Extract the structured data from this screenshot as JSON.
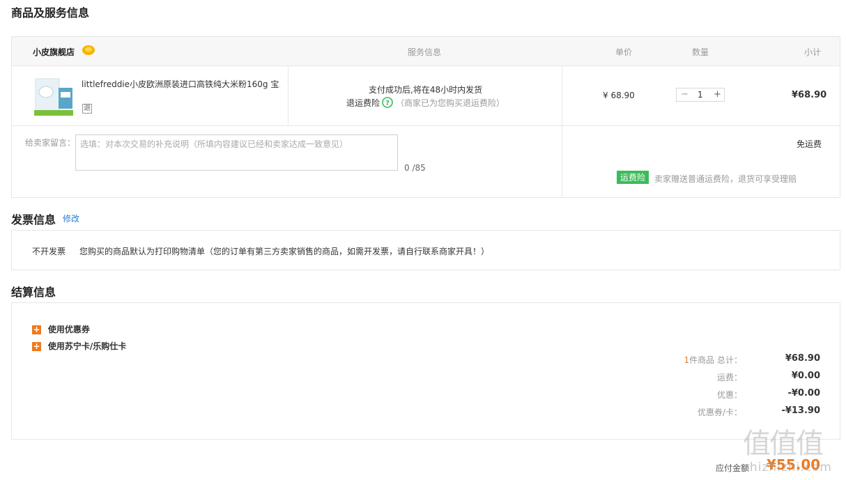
{
  "sections": {
    "goods_title": "商品及服务信息",
    "invoice_title": "发票信息",
    "invoice_edit": "修改",
    "settlement_title": "结算信息"
  },
  "order": {
    "store_name": "小皮旗舰店",
    "headers": {
      "service": "服务信息",
      "unit_price": "单价",
      "quantity": "数量",
      "subtotal": "小计"
    },
    "product": {
      "title": "littlefreddie小皮欧洲原装进口高铁纯大米粉160g 宝...",
      "badge": "退",
      "service_line1": "支付成功后,将在48小时内发货",
      "service_insurance": "退运费险",
      "service_insurance_note": "（商家已为您购买退运费险）",
      "price": "¥ 68.90",
      "quantity": "1",
      "minus": "−",
      "plus": "+",
      "subtotal": "¥68.90"
    },
    "message": {
      "label": "给卖家留言：",
      "placeholder": "选填：对本次交易的补充说明（所填内容建议已经和卖家达成一致意见）",
      "counter": "0 /85"
    },
    "shipping": {
      "free": "免运费",
      "insurance_tag": "运费险",
      "insurance_text": "卖家赠送普通运费险，退货可享受理赔"
    }
  },
  "invoice": {
    "type": "不开发票",
    "note": "您购买的商品默认为打印购物清单（您的订单有第三方卖家销售的商品，如需开发票，请自行联系商家开具！）"
  },
  "settlement": {
    "options": [
      {
        "label": "使用优惠券",
        "icon": "+"
      },
      {
        "label": "使用苏宁卡/乐购仕卡",
        "icon": "+"
      }
    ],
    "count": "1",
    "count_label": "件商品 总计：",
    "total": "¥68.90",
    "shipping_label": "运费：",
    "shipping": "¥0.00",
    "discount_label": "优惠：",
    "discount": "-¥0.00",
    "coupon_label": "优惠券/卡：",
    "coupon": "-¥13.90",
    "payable_label": "应付金额",
    "payable": "¥55.00"
  },
  "watermark": {
    "logo": "值",
    "site": "zhizhizhi.com"
  },
  "colors": {
    "accent_orange": "#f07a1d",
    "link_blue": "#2b7bd6",
    "insurance_green": "#3cbb5a"
  }
}
